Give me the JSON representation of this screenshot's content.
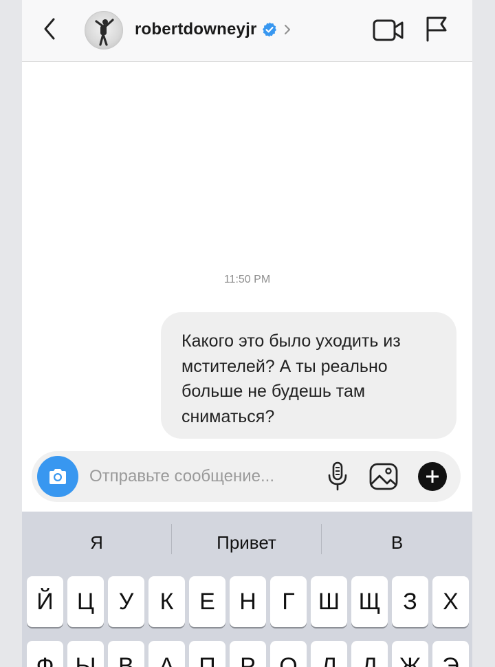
{
  "header": {
    "username": "robertdowneyjr",
    "verified_icon": "verified-badge-icon",
    "accent": "#3897f0"
  },
  "chat": {
    "timestamp": "11:50 PM",
    "messages": [
      {
        "from": "me",
        "text": "Какого это было уходить из мстителей? А ты реально больше не будешь там сниматься?"
      }
    ]
  },
  "composer": {
    "placeholder": "Отправьте сообщение...",
    "value": ""
  },
  "keyboard": {
    "suggestions": [
      "Я",
      "Привет",
      "В"
    ],
    "row1": [
      "Й",
      "Ц",
      "У",
      "К",
      "Е",
      "Н",
      "Г",
      "Ш",
      "Щ",
      "З",
      "Х"
    ],
    "row2": [
      "Ф",
      "Ы",
      "В",
      "А",
      "П",
      "Р",
      "О",
      "Л",
      "Д",
      "Ж",
      "Э"
    ]
  }
}
